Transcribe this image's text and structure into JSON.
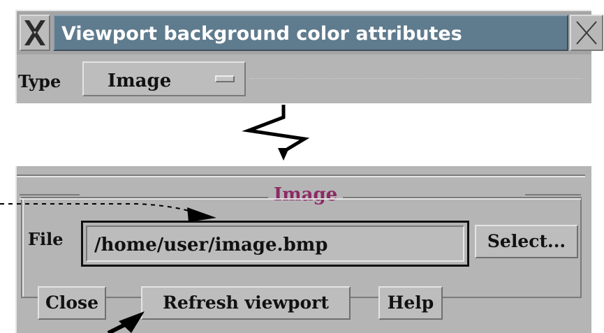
{
  "top_dialog": {
    "title": "Viewport background color attributes",
    "close_icon": "close-x-icon",
    "app_icon": "x-window-icon",
    "type_label": "Type",
    "type_value": "Image"
  },
  "bottom_dialog": {
    "group_title": "Image",
    "file_label": "File",
    "file_value": "/home/user/image.bmp",
    "select_label": "Select...",
    "buttons": {
      "close": "Close",
      "refresh": "Refresh viewport",
      "help": "Help"
    }
  },
  "colors": {
    "window_bg": "#b5b5b5",
    "titlebar_active": "#5f7b8e",
    "group_title": "#8c2a65"
  }
}
